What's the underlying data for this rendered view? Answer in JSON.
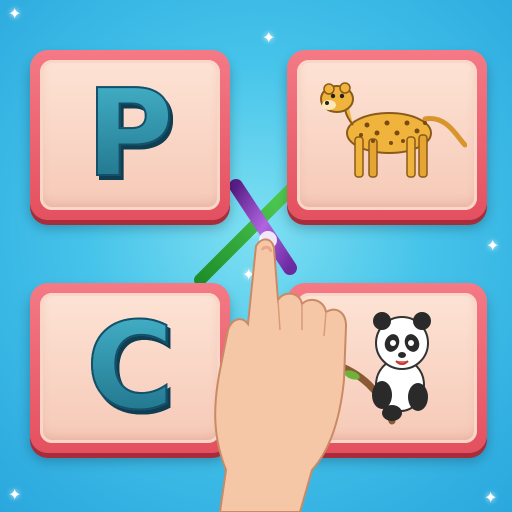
{
  "cards": [
    {
      "id": "p",
      "type": "letter",
      "letter": "P"
    },
    {
      "id": "cheetah",
      "type": "picture",
      "icon": "cheetah-icon"
    },
    {
      "id": "c",
      "type": "letter",
      "letter": "C"
    },
    {
      "id": "panda",
      "type": "picture",
      "icon": "panda-icon"
    }
  ],
  "connectors": [
    {
      "from": "P",
      "to": "panda",
      "color": "#8a3fb8"
    },
    {
      "from": "C",
      "to": "cheetah",
      "color": "#3bb23b"
    }
  ],
  "colors": {
    "background": "#45c3ea",
    "card_border": "#e4505f",
    "card_face": "#fde3d5",
    "letter": "#2a8ea8"
  }
}
